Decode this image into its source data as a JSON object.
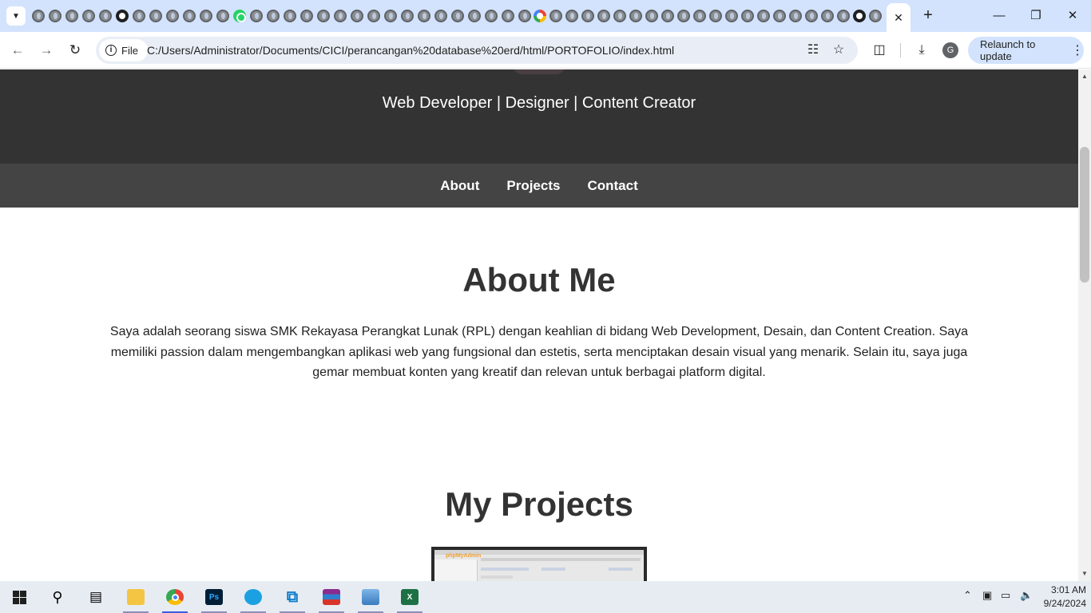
{
  "browser": {
    "url_scheme_chip": "File",
    "url": "C:/Users/Administrator/Documents/CICI/perancangan%20database%20erd/html/PORTOFOLIO/index.html",
    "relaunch_label": "Relaunch to update",
    "profile_initial": "G",
    "tab_count": 52,
    "active_tab_close": "✕",
    "new_tab": "+"
  },
  "page": {
    "subtitle": "Web Developer | Designer | Content Creator",
    "nav": [
      "About",
      "Projects",
      "Contact"
    ],
    "about_title": "About Me",
    "about_text": "Saya adalah seorang siswa SMK Rekayasa Perangkat Lunak (RPL) dengan keahlian di bidang Web Development, Desain, dan Content Creation. Saya memiliki passion dalam mengembangkan aplikasi web yang fungsional dan estetis, serta menciptakan desain visual yang menarik. Selain itu, saya juga gemar membuat konten yang kreatif dan relevan untuk berbagai platform digital.",
    "projects_title": "My Projects",
    "project_thumb_logo": "phpMyAdmin"
  },
  "taskbar": {
    "time": "3:01 AM",
    "date": "9/24/2024",
    "apps": [
      "start",
      "search",
      "task-view",
      "file-explorer",
      "chrome",
      "photoshop",
      "app",
      "vscode",
      "winrar",
      "photos",
      "excel"
    ]
  },
  "colors": {
    "hero_bg": "#333333",
    "nav_bg": "#444444",
    "tabstrip_bg": "#d3e3fd"
  }
}
